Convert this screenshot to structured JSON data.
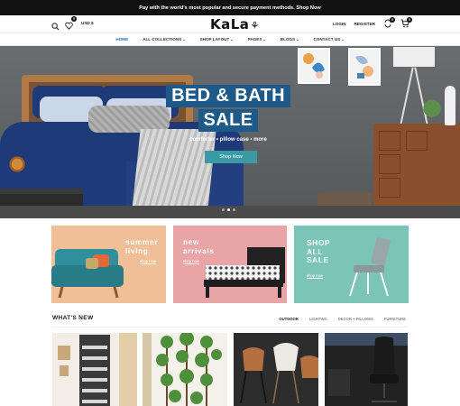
{
  "announcement": "Pay with the world's most popular and secure payment methods. Shop Now",
  "header": {
    "logo_text": "KaLa",
    "currency": "USD $",
    "wishlist_count": "0",
    "login": "LOGIN",
    "register": "REGISTER",
    "compare_count": "0",
    "cart_count": "0"
  },
  "nav": {
    "items": [
      {
        "label": "HOME",
        "caret": ""
      },
      {
        "label": "ALL COLLECTIONS",
        "caret": "⌄"
      },
      {
        "label": "SHOP LAYOUT",
        "caret": "⌄"
      },
      {
        "label": "PAGES",
        "caret": "⌄"
      },
      {
        "label": "BLOGS",
        "caret": "⌄"
      },
      {
        "label": "CONTACT US",
        "caret": "⌄"
      }
    ]
  },
  "hero": {
    "title_line1": "BED & BATH",
    "title_line2": "SALE",
    "subtitle": "comforter • pillow case • more",
    "button": "Shop Now",
    "slides": 3,
    "active_slide": 2
  },
  "promos": [
    {
      "title_line1": "summer",
      "title_line2": "living",
      "title_line3": "",
      "link": "shop now",
      "bg": "#f0bf98"
    },
    {
      "title_line1": "new",
      "title_line2": "arrivals",
      "title_line3": "",
      "link": "shop now",
      "bg": "#e9a5a6"
    },
    {
      "title_line1": "SHOP",
      "title_line2": "ALL",
      "title_line3": "SALE",
      "link": "shop now",
      "bg": "#7cc4b7"
    }
  ],
  "whats_new": {
    "title": "WHAT'S NEW",
    "tabs": [
      "OUTDOOR",
      "LIGHTING",
      "DECOR + PILLOWS",
      "FURNITURE"
    ]
  },
  "colors": {
    "accent_blue": "#1d5a8a",
    "button_teal": "#3b9ba4",
    "nav_active": "#2a6fb0"
  },
  "icons": [
    "search-icon",
    "heart-icon",
    "user-icon",
    "refresh-icon",
    "cart-icon"
  ]
}
